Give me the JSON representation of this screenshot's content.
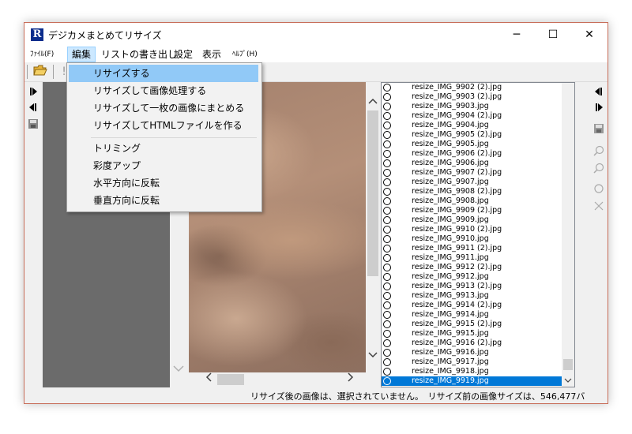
{
  "window": {
    "title": "デジカメまとめてリサイズ",
    "app_icon_letter": "R",
    "minimize_glyph": "─",
    "maximize_glyph": "☐",
    "close_glyph": "✕"
  },
  "menubar": {
    "items": [
      {
        "label": "ﾌｧｲﾙ(F)",
        "active": false
      },
      {
        "label": "編集",
        "active": true
      },
      {
        "label": "リストの書き出し",
        "active": false
      },
      {
        "label": "設定",
        "active": false
      },
      {
        "label": "表示",
        "active": false
      },
      {
        "label": "ﾍﾙﾌﾟ(H)",
        "active": false
      }
    ]
  },
  "toolbar": {
    "open_icon": "folder-open-icon",
    "second_icon": "exclamation-icon"
  },
  "dropdown": {
    "group1": [
      {
        "label": "リサイズする",
        "highlighted": true
      },
      {
        "label": "リサイズして画像処理する",
        "highlighted": false
      },
      {
        "label": "リサイズして一枚の画像にまとめる",
        "highlighted": false
      },
      {
        "label": "リサイズしてHTMLファイルを作る",
        "highlighted": false
      }
    ],
    "group2": [
      {
        "label": "トリミング"
      },
      {
        "label": "彩度アップ"
      },
      {
        "label": "水平方向に反転"
      },
      {
        "label": "垂直方向に反転"
      }
    ]
  },
  "file_list": [
    "resize_IMG_9902 (2).jpg",
    "resize_IMG_9903 (2).jpg",
    "resize_IMG_9903.jpg",
    "resize_IMG_9904 (2).jpg",
    "resize_IMG_9904.jpg",
    "resize_IMG_9905 (2).jpg",
    "resize_IMG_9905.jpg",
    "resize_IMG_9906 (2).jpg",
    "resize_IMG_9906.jpg",
    "resize_IMG_9907 (2).jpg",
    "resize_IMG_9907.jpg",
    "resize_IMG_9908 (2).jpg",
    "resize_IMG_9908.jpg",
    "resize_IMG_9909 (2).jpg",
    "resize_IMG_9909.jpg",
    "resize_IMG_9910 (2).jpg",
    "resize_IMG_9910.jpg",
    "resize_IMG_9911 (2).jpg",
    "resize_IMG_9911.jpg",
    "resize_IMG_9912 (2).jpg",
    "resize_IMG_9912.jpg",
    "resize_IMG_9913 (2).jpg",
    "resize_IMG_9913.jpg",
    "resize_IMG_9914 (2).jpg",
    "resize_IMG_9914.jpg",
    "resize_IMG_9915 (2).jpg",
    "resize_IMG_9915.jpg",
    "resize_IMG_9916 (2).jpg",
    "resize_IMG_9916.jpg",
    "resize_IMG_9917.jpg",
    "resize_IMG_9918.jpg",
    "resize_IMG_9919.jpg"
  ],
  "selected_file": "resize_IMG_9919.jpg",
  "status": {
    "text": "リサイズ後の画像は、選択されていません。　リサイズ前の画像サイズは、546,477バ"
  },
  "colors": {
    "accent": "#0078d7",
    "menu_highlight": "#91c9f7",
    "left_panel": "#6b6b6b",
    "frame": "#c86e5a"
  }
}
